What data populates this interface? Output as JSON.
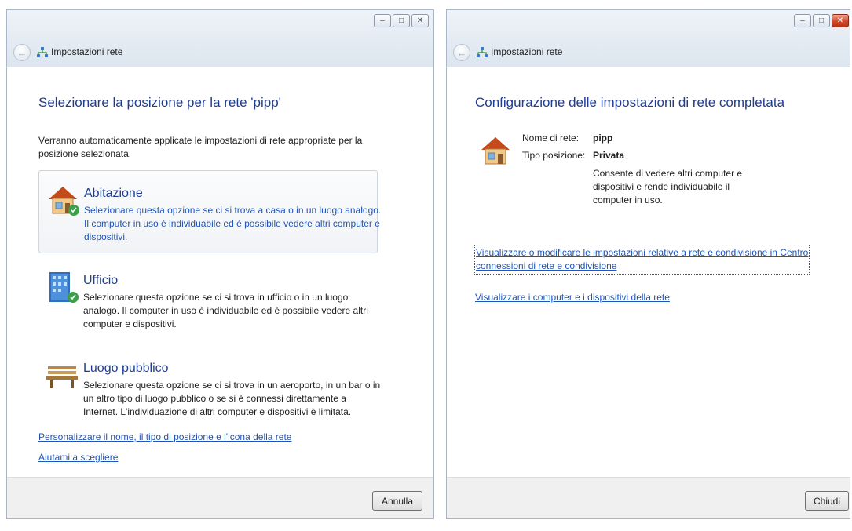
{
  "left_window": {
    "title": "Impostazioni rete",
    "controls": {
      "minimize": "–",
      "maximize": "□",
      "close": "✕"
    },
    "heading": "Selezionare la posizione per la rete 'pipp'",
    "intro": "Verranno automaticamente applicate le impostazioni di rete appropriate per la posizione selezionata.",
    "options": [
      {
        "title": "Abitazione",
        "description": "Selezionare questa opzione se ci si trova a casa o in un luogo analogo. Il computer in uso è individuabile ed è possibile vedere altri computer e dispositivi.",
        "icon": "house-icon"
      },
      {
        "title": "Ufficio",
        "description": "Selezionare questa opzione se ci si trova in ufficio o in un luogo analogo. Il computer in uso è individuabile ed è possibile vedere altri computer e dispositivi.",
        "icon": "office-building-icon"
      },
      {
        "title": "Luogo pubblico",
        "description": "Selezionare questa opzione se ci si trova in un aeroporto, in un bar o in un altro tipo di luogo pubblico o se si è connessi direttamente a Internet. L'individuazione di altri computer e dispositivi è limitata.",
        "icon": "park-bench-icon"
      }
    ],
    "links": {
      "customize": "Personalizzare il nome, il tipo di posizione e l'icona della rete",
      "help": "Aiutami a scegliere"
    },
    "cancel_button": "Annulla"
  },
  "right_window": {
    "title": "Impostazioni rete",
    "controls": {
      "minimize": "–",
      "maximize": "□",
      "close": "✕"
    },
    "heading": "Configurazione delle impostazioni di rete completata",
    "network_name_label": "Nome di rete:",
    "network_name_value": "pipp",
    "location_type_label": "Tipo posizione:",
    "location_type_value": "Privata",
    "location_description": "Consente di vedere altri computer e dispositivi e rende individuabile il computer in uso.",
    "links": {
      "network_center": "Visualizzare o modificare le impostazioni relative a rete e condivisione in Centro connessioni di rete e condivisione",
      "network_center_line1": "Visualizzare o modificare le impostazioni relative a rete e condivisione in Centro",
      "network_center_line2": "connessioni di rete e condivisione",
      "view_devices": "Visualizzare i computer e i dispositivi della rete"
    },
    "close_button": "Chiudi"
  },
  "colors": {
    "heading_blue": "#1f3e8f",
    "link_blue": "#1f55b8",
    "titlebar": "#e3eaf2",
    "footer": "#f0f0f0",
    "close_red": "#cf4a2a"
  }
}
